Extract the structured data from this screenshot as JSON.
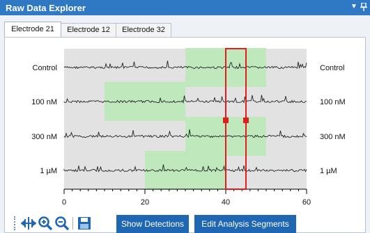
{
  "window": {
    "title": "Raw Data Explorer"
  },
  "tabs": [
    {
      "label": "Electrode 21",
      "active": true
    },
    {
      "label": "Electrode 12",
      "active": false
    },
    {
      "label": "Electrode 32",
      "active": false
    }
  ],
  "chart_data": {
    "type": "line",
    "rows": [
      {
        "label": "Control",
        "highlight": [
          [
            30,
            50
          ]
        ]
      },
      {
        "label": "100 nM",
        "highlight": [
          [
            10,
            30
          ]
        ]
      },
      {
        "label": "300 nM",
        "highlight": [
          [
            30,
            50
          ]
        ]
      },
      {
        "label": "1 µM",
        "highlight": [
          [
            20,
            40
          ]
        ]
      }
    ],
    "x_ticks": [
      "0",
      "20",
      "40",
      "60"
    ],
    "xlim": [
      0,
      60
    ],
    "selection": [
      40,
      45
    ],
    "colors": {
      "plot_bg": "#e2e2e2",
      "highlight": "#bfe8bd",
      "trace": "#222222",
      "selection": "#e21b1b"
    }
  },
  "toolbar": {
    "icons": [
      "pan-zoom-icon",
      "zoom-in-icon",
      "zoom-out-icon",
      "save-icon"
    ],
    "show_detections": "Show Detections",
    "edit_segments": "Edit Analysis Segments"
  }
}
